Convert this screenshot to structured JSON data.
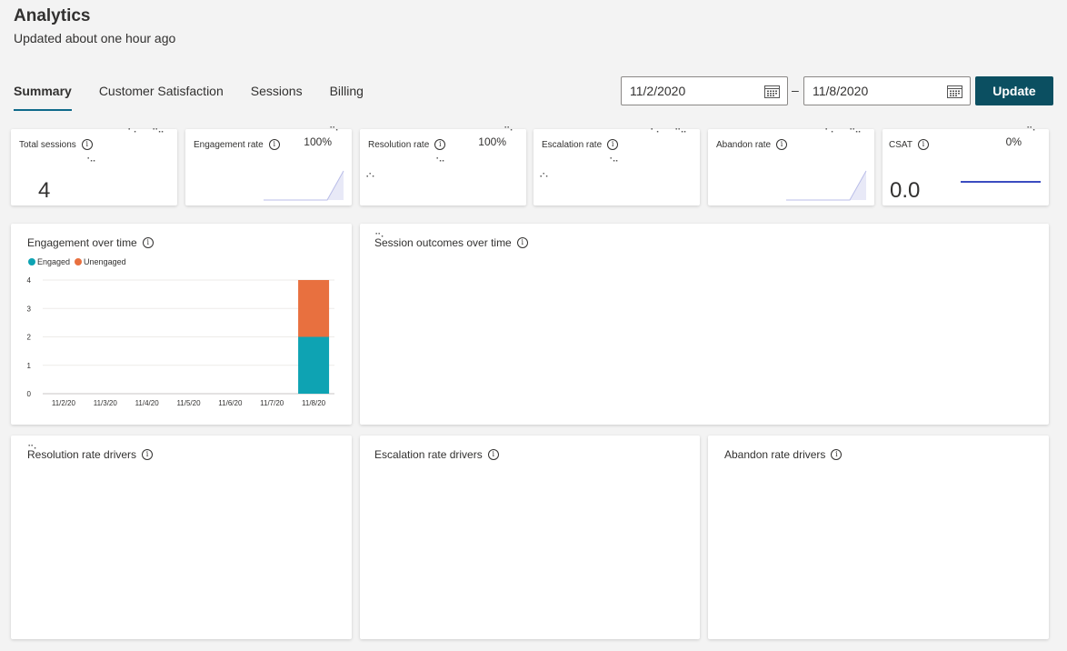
{
  "header": {
    "title": "Analytics",
    "subtitle": "Updated about one hour ago"
  },
  "tabs": [
    {
      "label": "Summary",
      "active": true
    },
    {
      "label": "Customer Satisfaction",
      "active": false
    },
    {
      "label": "Sessions",
      "active": false
    },
    {
      "label": "Billing",
      "active": false
    }
  ],
  "date_range": {
    "start": "11/2/2020",
    "end": "11/8/2020",
    "separator": "–",
    "update_label": "Update"
  },
  "kpis": {
    "total_sessions": {
      "label": "Total sessions",
      "value": "4"
    },
    "engagement_rate": {
      "label": "Engagement rate",
      "percent": "100%"
    },
    "resolution_rate": {
      "label": "Resolution rate",
      "percent": "100%"
    },
    "escalation_rate": {
      "label": "Escalation rate"
    },
    "abandon_rate": {
      "label": "Abandon rate"
    },
    "csat": {
      "label": "CSAT",
      "percent": "0%",
      "value": "0.0"
    }
  },
  "panels": {
    "engagement_over_time": "Engagement over time",
    "session_outcomes": "Session outcomes over time",
    "resolution_drivers": "Resolution rate drivers",
    "escalation_drivers": "Escalation rate drivers",
    "abandon_drivers": "Abandon rate drivers"
  },
  "colors": {
    "engaged": "#0ea3b3",
    "unengaged": "#e8703f",
    "accent": "#0b4f61",
    "csat_line": "#3b4cc0"
  },
  "chart_data": {
    "type": "bar",
    "stacked": true,
    "categories": [
      "11/2/20",
      "11/3/20",
      "11/4/20",
      "11/5/20",
      "11/6/20",
      "11/7/20",
      "11/8/20"
    ],
    "series": [
      {
        "name": "Engaged",
        "values": [
          0,
          0,
          0,
          0,
          0,
          0,
          2
        ]
      },
      {
        "name": "Unengaged",
        "values": [
          0,
          0,
          0,
          0,
          0,
          0,
          2
        ]
      }
    ],
    "yticks": [
      0,
      1,
      2,
      3,
      4
    ],
    "ylim": [
      0,
      4
    ],
    "grid": true,
    "legend": "top-left"
  }
}
